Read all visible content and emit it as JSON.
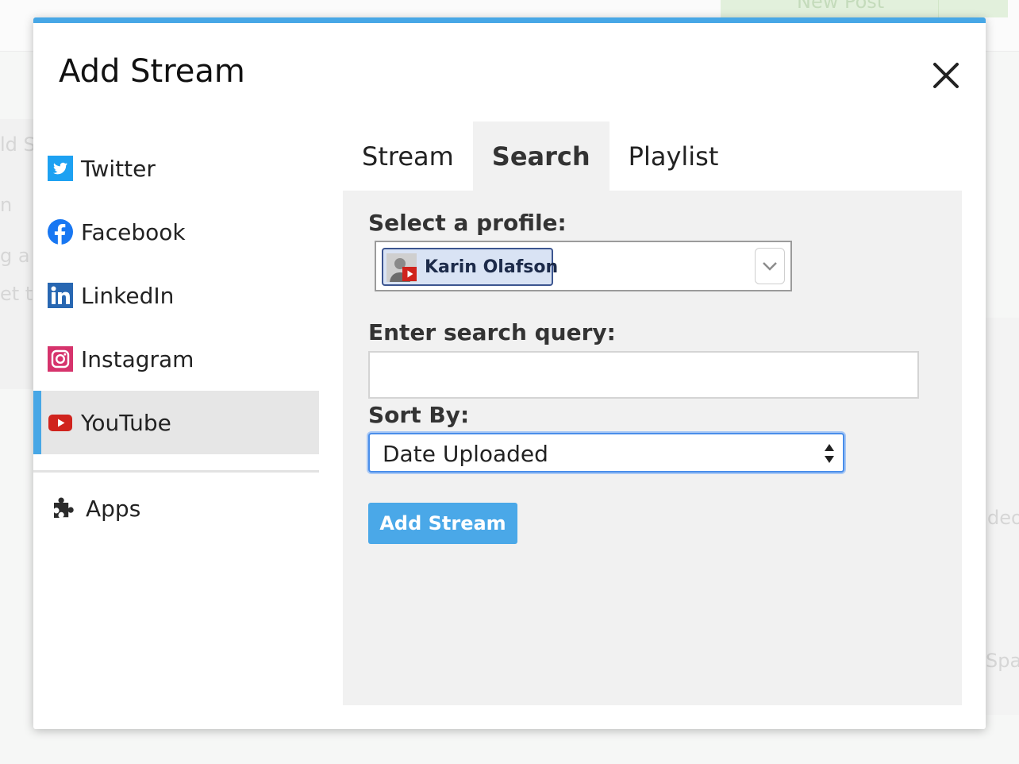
{
  "background": {
    "new_post_label": "New Post",
    "faint_texts": [
      "ld Se",
      "n",
      "g a f",
      "et t",
      "deo",
      "Spar"
    ]
  },
  "modal": {
    "title": "Add Stream",
    "close_label": "×"
  },
  "sidebar": {
    "items": [
      {
        "label": "Twitter",
        "icon": "twitter-icon",
        "color": "#1da1f2"
      },
      {
        "label": "Facebook",
        "icon": "facebook-icon",
        "color": "#1877f2"
      },
      {
        "label": "LinkedIn",
        "icon": "linkedin-icon",
        "color": "#2867b2"
      },
      {
        "label": "Instagram",
        "icon": "instagram-icon",
        "color": "#d6336c"
      },
      {
        "label": "YouTube",
        "icon": "youtube-icon",
        "color": "#d0231d",
        "active": true
      }
    ],
    "apps_label": "Apps"
  },
  "tabs": [
    {
      "label": "Stream"
    },
    {
      "label": "Search",
      "active": true
    },
    {
      "label": "Playlist"
    }
  ],
  "form": {
    "profile_label": "Select a profile:",
    "profile_name": "Karin Olafson",
    "query_label": "Enter search query:",
    "query_value": "",
    "sort_label": "Sort By:",
    "sort_value": "Date Uploaded",
    "submit_label": "Add Stream"
  },
  "colors": {
    "accent": "#47a7e6",
    "button": "#4aa8e8",
    "chip_bg": "#d9e3f4",
    "chip_border": "#3c5590"
  }
}
